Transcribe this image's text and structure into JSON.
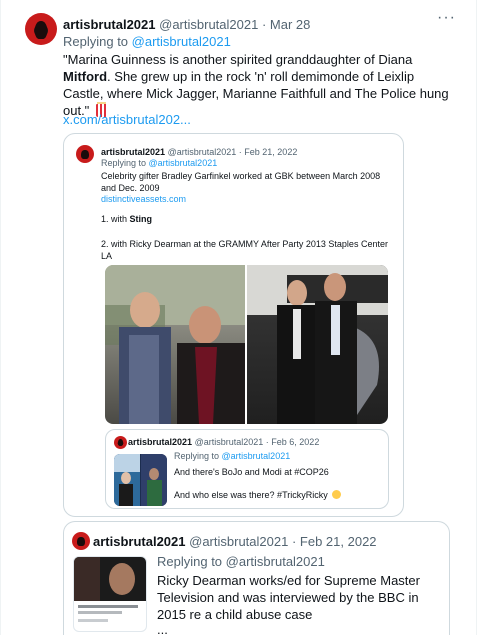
{
  "main_tweet": {
    "name": "artisbrutal2021",
    "handle": "@artisbrutal2021",
    "sep": "·",
    "date": "Mar 28",
    "replying_prefix": "Replying to ",
    "replying_handle": "@artisbrutal2021",
    "text_part1": "\"Marina Guinness is another spirited granddaughter of Diana ",
    "text_bold": "Mitford",
    "text_part2": ". She grew up in the rock 'n' roll demimonde of Leixlip Castle, where Mick Jagger, Marianne Faithfull and The Police hung out.\"",
    "emoji_name": "popcorn-icon",
    "link": "x.com/artisbrutal202...",
    "more_icon": "more-icon"
  },
  "quote1": {
    "name": "artisbrutal2021",
    "handle": "@artisbrutal2021",
    "sep": "·",
    "date": "Feb 21, 2022",
    "replying_prefix": "Replying to ",
    "replying_handle": "@artisbrutal2021",
    "line1": "Celebrity gifter Bradley Garfinkel worked at GBK between March 2008 and Dec. 2009",
    "link": "distinctiveassets.com",
    "item1_prefix": "1. with ",
    "item1_bold": "Sting",
    "item2": "2. with Ricky Dearman at the GRAMMY After Party 2013 Staples Center LA"
  },
  "nested_quote": {
    "name": "artisbrutal2021",
    "handle": "@artisbrutal2021",
    "sep": "·",
    "date": "Feb 6, 2022",
    "replying_prefix": "Replying to ",
    "replying_handle": "@artisbrutal2021",
    "line1": "And there's BoJo and Modi at #COP26",
    "line2": "And who else was there? #TrickyRicky",
    "emoji_name": "grimace-face-icon"
  },
  "quote2": {
    "name": "artisbrutal2021",
    "handle": "@artisbrutal2021",
    "sep": "·",
    "date": "Feb 21, 2022",
    "replying_prefix": "Replying to ",
    "replying_handle": "@artisbrutal2021",
    "text": "Ricky Dearman works/ed for Supreme Master Television and was interviewed by the BBC in 2015 re a child abuse case",
    "ellipsis": "..."
  },
  "colors": {
    "link": "#1d9bf0",
    "muted": "#536471",
    "border": "#cfd9de",
    "text": "#0f1419"
  }
}
